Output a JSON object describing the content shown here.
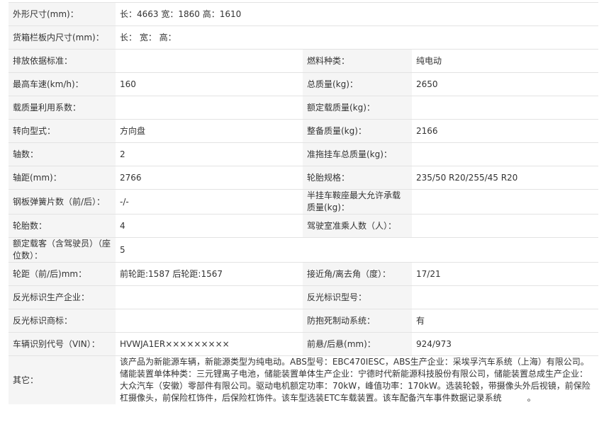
{
  "spec_table": {
    "rows": [
      {
        "label": "外形尺寸(mm)：",
        "value": "长：4663 宽：1860 高：1610"
      },
      {
        "label": "货箱栏板内尺寸(mm)：",
        "value": "长： 宽： 高："
      },
      {
        "label": "排放依据标准：",
        "value": "",
        "label2": "燃料种类：",
        "value2": "纯电动"
      },
      {
        "label": "最高车速(km/h)：",
        "value": "160",
        "label2": "总质量(kg)：",
        "value2": "2650"
      },
      {
        "label": "载质量利用系数：",
        "value": "",
        "label2": "额定载质量(kg)：",
        "value2": ""
      },
      {
        "label": "转向型式：",
        "value": "方向盘",
        "label2": "整备质量(kg)：",
        "value2": "2166"
      },
      {
        "label": "轴数：",
        "value": "2",
        "label2": "准拖挂车总质量(kg)：",
        "value2": ""
      },
      {
        "label": "轴距(mm)：",
        "value": "2766",
        "label2": "轮胎规格：",
        "value2": "235/50 R20/255/45 R20"
      },
      {
        "label": "钢板弹簧片数（前/后）：",
        "value": "-/-",
        "label2": "半挂车鞍座最大允许承载质量(kg)：",
        "value2": ""
      },
      {
        "label": "轮胎数：",
        "value": "4",
        "label2": "驾驶室准乘人数（人）：",
        "value2": ""
      },
      {
        "label": "额定载客（含驾驶员）（座位数）：",
        "value": "5"
      },
      {
        "label": "轮距（前/后)mm：",
        "value": "前轮距:1587 后轮距:1567",
        "label2": "接近角/离去角（度）：",
        "value2": "17/21"
      },
      {
        "label": "反光标识生产企业：",
        "value": "",
        "label2": "反光标识型号：",
        "value2": ""
      },
      {
        "label": "反光标识商标：",
        "value": "",
        "label2": "防抱死制动系统：",
        "value2": "有"
      },
      {
        "label": "车辆识别代号（VIN）：",
        "value": "HVWJA1ER×××××××××",
        "label2": "前悬/后悬(mm)：",
        "value2": "924/973"
      },
      {
        "label": "其它：",
        "value": "该产品为新能源车辆，新能源类型为纯电动。ABS型号：EBC470IESC，ABS生产企业：采埃孚汽车系统（上海）有限公司。储能装置单体种类：三元锂离子电池，储能装置单体生产企业：宁德时代新能源科技股份有限公司，储能装置总成生产企业：大众汽车（安徽）零部件有限公司。驱动电机额定功率：70kW，峰值功率：170kW。选装轮毂，带摄像头外后视镜，前保险杠摄像头，前保险杠饰件，后保险杠饰件。该车型选装ETC车载装置。该车配备汽车事件数据记录系统　　　。"
      }
    ]
  }
}
